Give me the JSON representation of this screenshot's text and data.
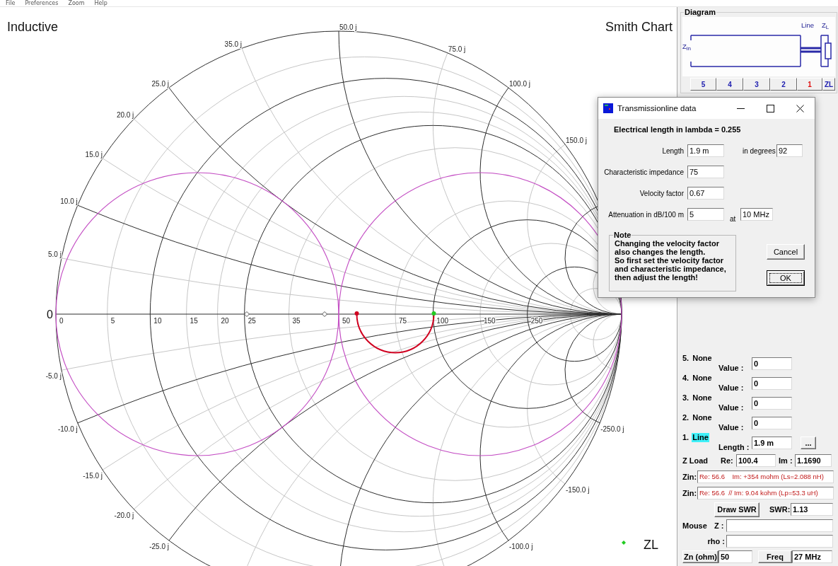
{
  "menu": [
    {
      "label": "File"
    },
    {
      "label": "Preferences"
    },
    {
      "label": "Zoom"
    },
    {
      "label": "Help"
    }
  ],
  "chart": {
    "corner_label": "Inductive",
    "title": "Smith Chart",
    "origin_label": "0",
    "resistance_labels": [
      "0",
      "5",
      "10",
      "15",
      "20",
      "25",
      "35",
      "50",
      "75",
      "100",
      "150",
      "250"
    ],
    "reactance_labels": [
      "5.0 j",
      "10.0 j",
      "15.0 j",
      "20.0 j",
      "25.0 j",
      "35.0 j",
      "50.0 j",
      "75.0 j",
      "100.0 j",
      "150.0 j"
    ],
    "negative_reactance_labels": [
      "-5.0 j",
      "-10.0 j",
      "-15.0 j",
      "-20.0 j",
      "-25.0 j",
      "-100.0 j",
      "-150.0 j",
      "-250.0 j"
    ],
    "legend": [
      {
        "label": "ZL"
      }
    ]
  },
  "diagram": {
    "title": "Diagram",
    "input_label": "Z$_{in}$",
    "line_label": "Line",
    "load_label": "Z$_{L}$",
    "buttons": [
      {
        "label": "5",
        "selected": false
      },
      {
        "label": "4",
        "selected": false
      },
      {
        "label": "3",
        "selected": false
      },
      {
        "label": "2",
        "selected": false
      },
      {
        "label": "1",
        "selected": true
      },
      {
        "label": "ZL",
        "selected": false
      }
    ]
  },
  "components": [
    {
      "number": "5.",
      "name": "None",
      "field_label": "Value :",
      "value": "0",
      "selected": false
    },
    {
      "number": "4.",
      "name": "None",
      "field_label": "Value :",
      "value": "0",
      "selected": false
    },
    {
      "number": "3.",
      "name": "None",
      "field_label": "Value :",
      "value": "0",
      "selected": false
    },
    {
      "number": "2.",
      "name": "None",
      "field_label": "Value :",
      "value": "0",
      "selected": false
    },
    {
      "number": "1.",
      "name": "Line",
      "field_label": "Length :",
      "value": "1.9 m",
      "selected": true,
      "button": "..."
    }
  ],
  "load": {
    "label": "Z Load",
    "re_label": "Re:",
    "re": "100.4",
    "im_label": "Im :",
    "im": "1.1690"
  },
  "zin": [
    {
      "label": "Zin:",
      "value": "Re: 56.6    Im: +354 mohm (Ls=2.088 nH)"
    },
    {
      "label": "Zin:",
      "value": "Re: 56.6  // Im: 9.04 kohm (Lp=53.3 uH)"
    }
  ],
  "swr": {
    "button": "Draw SWR",
    "label": "SWR:",
    "value": "1.13"
  },
  "mouse": {
    "label": "Mouse",
    "fields": [
      {
        "label": "Z :"
      },
      {
        "label": "rho :"
      }
    ]
  },
  "footer": [
    {
      "button": "Zn (ohm)",
      "value": "50"
    },
    {
      "button": "Freq",
      "value": "27 MHz"
    }
  ],
  "dialog": {
    "title": "Transmissionline data",
    "heading": "Electrical length in lambda = 0.255",
    "fields": [
      {
        "label": "Length",
        "value": "1.9 m",
        "extra": {
          "label": "in degrees",
          "value": "92"
        }
      },
      {
        "label": "Characteristic impedance",
        "value": "75"
      },
      {
        "label": "Velocity factor",
        "value": "0.67"
      },
      {
        "label": "Attenuation in dB/100 m",
        "value": "5",
        "extra": {
          "label": "at",
          "value": "10 MHz"
        }
      }
    ],
    "note": {
      "title": "Note",
      "text": "Changing the velocity factor\nalso changes the length.\nSo first set the velocity factor\nand characteristic impedance,\nthen adjust the length!"
    },
    "buttons": [
      {
        "label": "Cancel",
        "default": false
      },
      {
        "label": "OK",
        "default": true
      }
    ]
  }
}
